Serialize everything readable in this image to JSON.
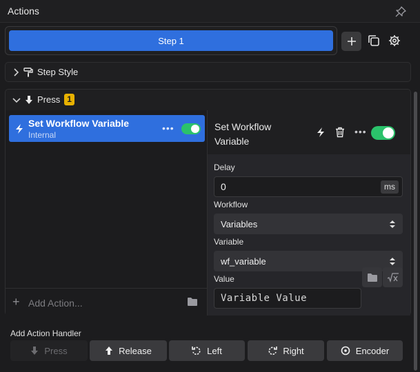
{
  "panel": {
    "title": "Actions"
  },
  "step": {
    "label": "Step 1"
  },
  "sections": {
    "step_style": {
      "label": "Step Style"
    },
    "press": {
      "label": "Press",
      "badge": "1"
    }
  },
  "actions": [
    {
      "name": "Set Workflow Variable",
      "subtitle": "Internal",
      "enabled": true
    }
  ],
  "add_action": {
    "label": "Add Action..."
  },
  "detail": {
    "title": "Set Workflow Variable",
    "enabled": true,
    "delay": {
      "label": "Delay",
      "value": "0",
      "unit": "ms"
    },
    "workflow": {
      "label": "Workflow",
      "value": "Variables"
    },
    "variable": {
      "label": "Variable",
      "value": "wf_variable"
    },
    "value": {
      "label": "Value",
      "placeholder": "Variable Value"
    }
  },
  "handlers": {
    "label": "Add Action Handler",
    "buttons": [
      {
        "label": "Press",
        "enabled": false
      },
      {
        "label": "Release",
        "enabled": true
      },
      {
        "label": "Left",
        "enabled": true
      },
      {
        "label": "Right",
        "enabled": true
      },
      {
        "label": "Encoder",
        "enabled": true
      }
    ]
  },
  "colors": {
    "accent": "#2f6fde",
    "toggle_on": "#2bc26b",
    "badge": "#e8b100"
  }
}
